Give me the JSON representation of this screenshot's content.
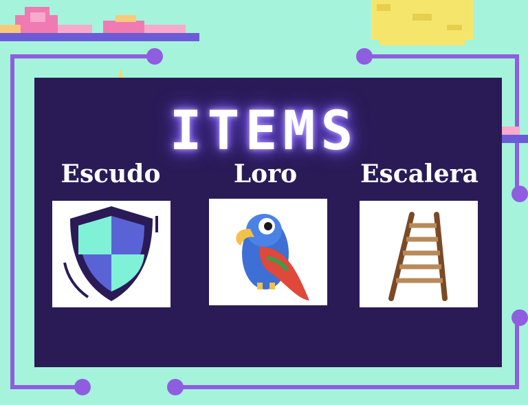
{
  "title": "ITEMS",
  "items": [
    {
      "label": "Escudo",
      "icon": "shield-icon"
    },
    {
      "label": "Loro",
      "icon": "parrot-icon"
    },
    {
      "label": "Escalera",
      "icon": "ladder-icon"
    }
  ],
  "colors": {
    "background": "#a6f3dc",
    "panel": "#2a1b57",
    "circuit": "#8f5de0",
    "text": "#ffffff"
  }
}
